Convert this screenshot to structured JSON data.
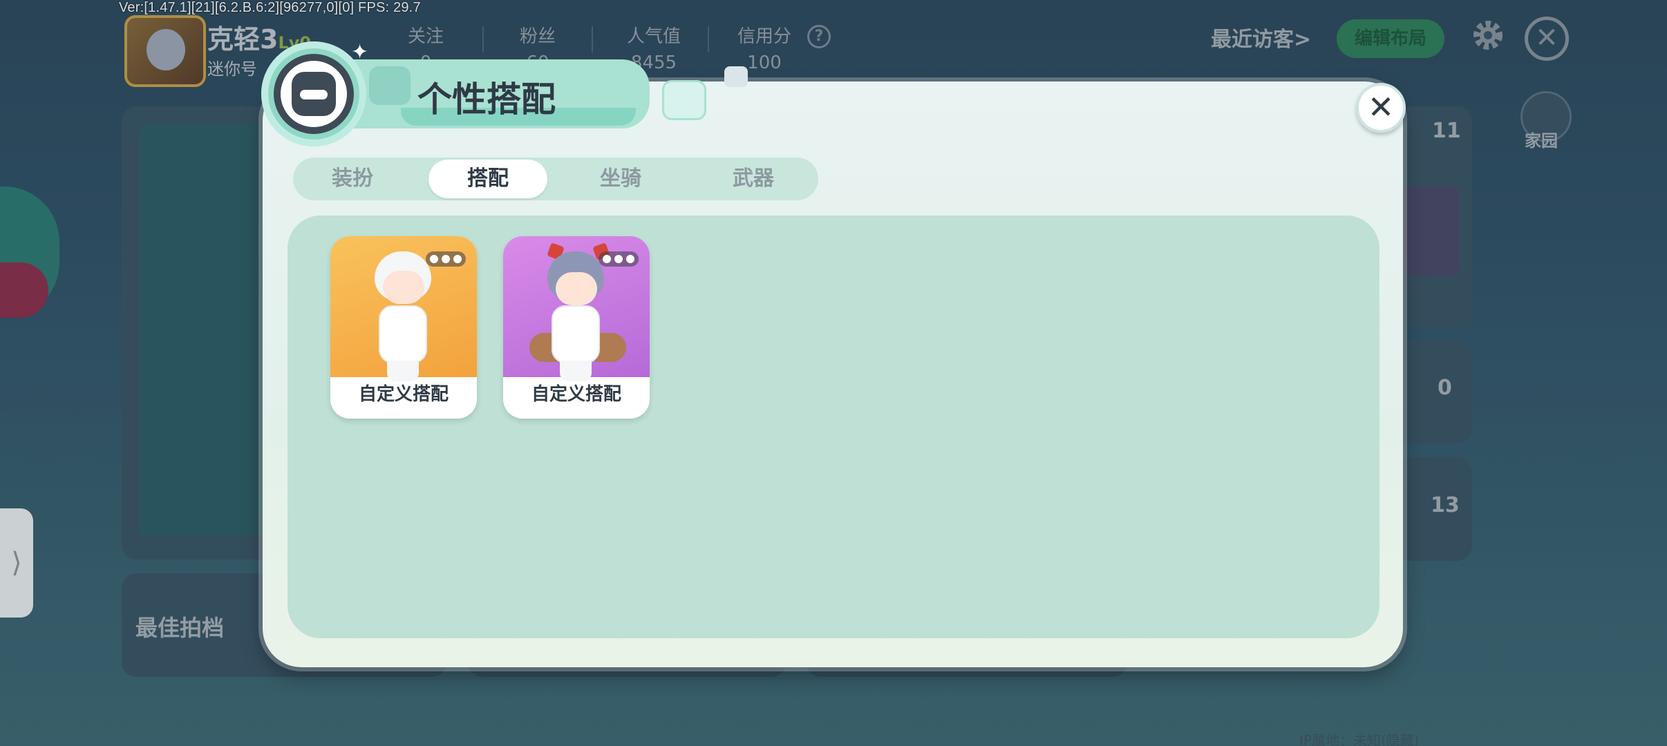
{
  "debug": {
    "version_fps": "Ver:[1.47.1][21][6.2.B.6:2][96277,0][0] FPS: 29.7"
  },
  "profile": {
    "nickname": "克轻3",
    "level": "Lv0",
    "mini_id": "迷你号",
    "stats": [
      {
        "label": "关注",
        "value": "0"
      },
      {
        "label": "粉丝",
        "value": "60"
      },
      {
        "label": "人气值",
        "value": "8455"
      },
      {
        "label": "信用分",
        "value": "100"
      }
    ]
  },
  "header": {
    "recent_visitors": "最近访客>",
    "edit_layout": "编辑布局",
    "home_label": "家园"
  },
  "side_counts": [
    "11",
    "0",
    "13"
  ],
  "best_partner": "最佳拍档",
  "side_tab_glyph": "⟩",
  "bottom_note": "IP属地：未知(隐藏)",
  "modal": {
    "title": "个性搭配",
    "close_glyph": "✕",
    "tabs": [
      {
        "label": "装扮",
        "active": false
      },
      {
        "label": "搭配",
        "active": true
      },
      {
        "label": "坐骑",
        "active": false
      },
      {
        "label": "武器",
        "active": false
      }
    ],
    "outfits": [
      {
        "label": "自定义搭配",
        "theme": "orange",
        "bg": "#f6b14a",
        "hair": "#f4f6f8"
      },
      {
        "label": "自定义搭配",
        "theme": "purple",
        "bg": "#c97be0",
        "hair": "#8d97b5"
      }
    ]
  }
}
